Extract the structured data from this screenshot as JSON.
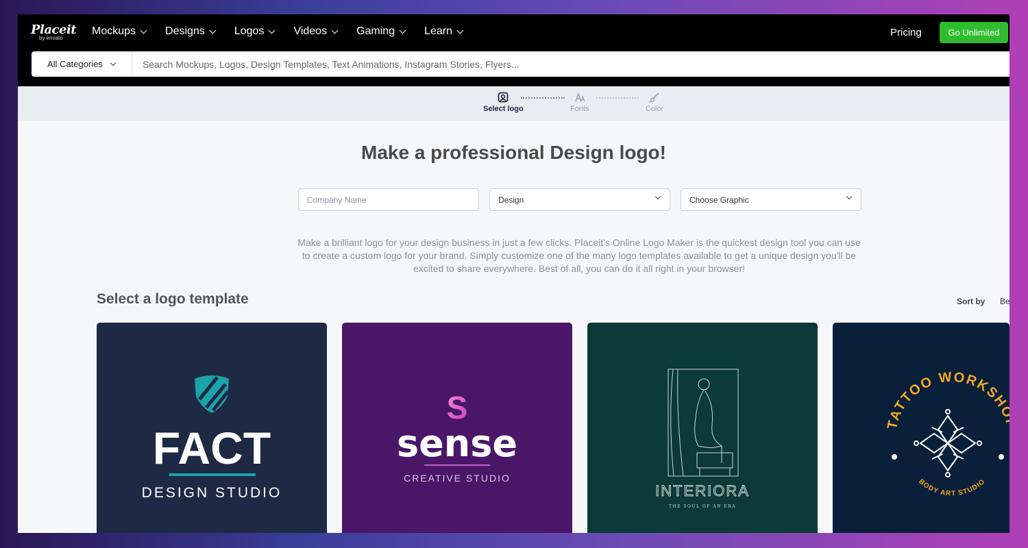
{
  "brand": {
    "name": "Placeit",
    "sub": "by envato"
  },
  "nav": {
    "items": [
      {
        "label": "Mockups"
      },
      {
        "label": "Designs"
      },
      {
        "label": "Logos"
      },
      {
        "label": "Videos"
      },
      {
        "label": "Gaming"
      },
      {
        "label": "Learn"
      }
    ],
    "pricing": "Pricing",
    "cta": "Go Unlimited"
  },
  "search": {
    "category": "All Categories",
    "placeholder": "Search Mockups, Logos, Design Templates, Text Animations, Instagram Stories, Flyers..."
  },
  "steps": [
    {
      "label": "Select logo",
      "icon": "logo-icon",
      "active": true
    },
    {
      "label": "Fonts",
      "icon": "font-icon",
      "active": false
    },
    {
      "label": "Color",
      "icon": "brush-icon",
      "active": false
    }
  ],
  "main": {
    "headline": "Make a professional Design logo!",
    "company_placeholder": "Company Name",
    "industry_value": "Design",
    "graphic_value": "Choose Graphic",
    "description": "Make a brilliant logo for your design business in just a few clicks. Placeit's Online Logo Maker is the quickest design tool you can use to create a custom logo for your brand. Simply customize one of the many logo templates available to get a unique design you'll be excited to share everywhere. Best of all, you can do it all right in your browser!",
    "section_title": "Select a logo template",
    "sort_label": "Sort by",
    "sort_value": "Be"
  },
  "templates": [
    {
      "title": "FACT",
      "subtitle": "DESIGN STUDIO",
      "bg": "#1e2a44",
      "accent": "#1aa3a8"
    },
    {
      "title": "sense",
      "subtitle": "CREATIVE STUDIO",
      "bg": "#4a1768",
      "accent": "#e060c8"
    },
    {
      "title": "INTERIORA",
      "subtitle": "THE SOUL OF AN ERA",
      "bg": "#0b3a37",
      "accent": "#cfd8d6"
    },
    {
      "title": "TATTOO WORKSHOP",
      "subtitle": "BODY ART STUDIO",
      "bg": "#0a1f3a",
      "accent": "#f2a623"
    }
  ]
}
